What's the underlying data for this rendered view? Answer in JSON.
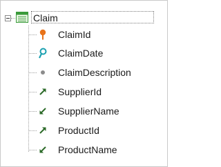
{
  "tree": {
    "root": {
      "label": "Claim",
      "icon": "transaction-table-icon",
      "expanded": true
    },
    "attributes": [
      {
        "label": "ClaimId",
        "icon": "primary-key-icon"
      },
      {
        "label": "ClaimDate",
        "icon": "search-key-icon"
      },
      {
        "label": "ClaimDescription",
        "icon": "attribute-dot-icon"
      },
      {
        "label": "SupplierId",
        "icon": "foreign-key-arrow-icon"
      },
      {
        "label": "SupplierName",
        "icon": "inferred-attribute-arrow-icon"
      },
      {
        "label": "ProductId",
        "icon": "foreign-key-arrow-icon"
      },
      {
        "label": "ProductName",
        "icon": "inferred-attribute-arrow-icon"
      }
    ]
  },
  "colors": {
    "primary_key": "#e8731a",
    "search_key": "#1aa0b0",
    "attribute_dot": "#8c8c8c",
    "fk_arrow": "#2d6b2a",
    "table_icon": "#3a9a3a"
  }
}
